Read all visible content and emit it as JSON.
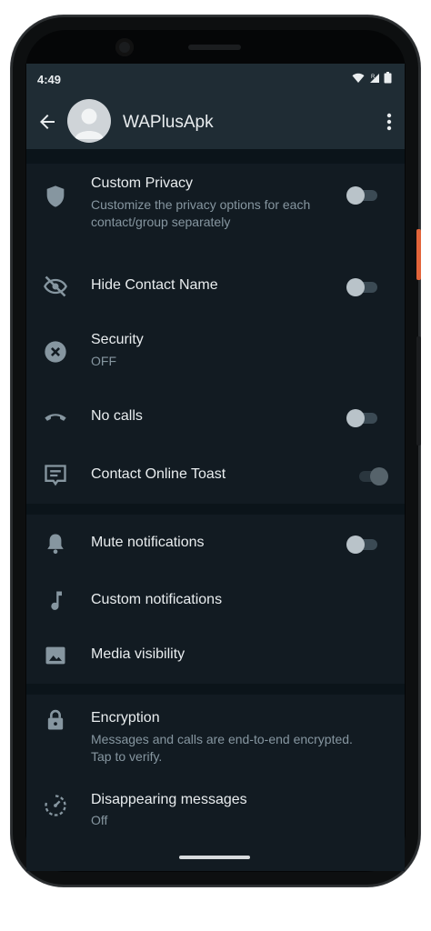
{
  "status": {
    "time": "4:49"
  },
  "header": {
    "title": "WAPlusApk"
  },
  "colors": {
    "background": "#121b22",
    "header": "#1f2c34",
    "text": "#e9edef",
    "subtext": "#8696a0"
  },
  "items": [
    {
      "title": "Custom Privacy",
      "subtitle": "Customize the privacy options for each contact/group separately",
      "icon": "shield-icon",
      "toggle": "off"
    },
    {
      "title": "Hide Contact Name",
      "icon": "eye-off-icon",
      "toggle": "off"
    },
    {
      "title": "Security",
      "subtitle": "OFF",
      "icon": "close-circle-icon"
    },
    {
      "title": "No calls",
      "icon": "phone-hangup-icon",
      "toggle": "off"
    },
    {
      "title": "Contact Online Toast",
      "icon": "message-icon",
      "toggle": "disabled"
    },
    {
      "title": "Mute notifications",
      "icon": "bell-icon",
      "toggle": "off"
    },
    {
      "title": "Custom notifications",
      "icon": "music-note-icon"
    },
    {
      "title": "Media visibility",
      "icon": "image-icon"
    },
    {
      "title": "Encryption",
      "subtitle": "Messages and calls are end-to-end encrypted. Tap to verify.",
      "icon": "lock-icon"
    },
    {
      "title": "Disappearing messages",
      "subtitle": "Off",
      "icon": "timer-icon"
    }
  ]
}
